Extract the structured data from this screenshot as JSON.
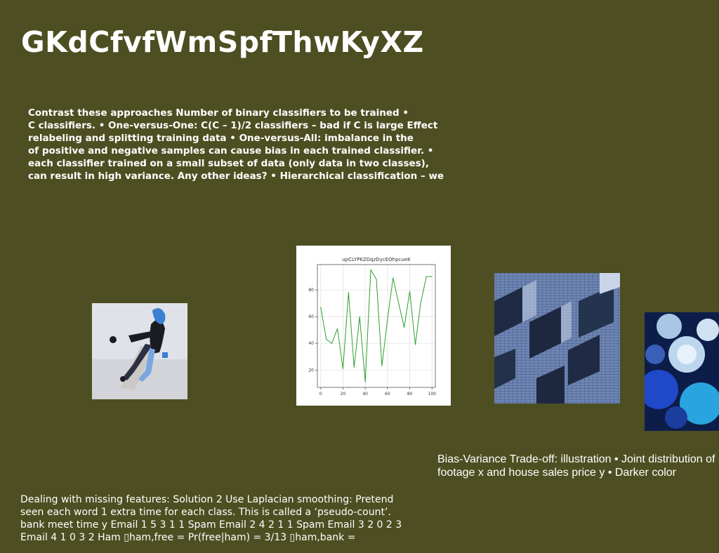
{
  "slide": {
    "title": "GKdCfvfWmSpfThwKyXZ",
    "paragraph": "Contrast these approaches Number of binary classifiers to be trained •\nC classifiers. • One-versus-One: C(C – 1)/2 classifiers – bad if C is large Effect\nrelabeling and splitting training data • One-versus-All: imbalance in the\nof positive and negative samples can cause bias in each trained classifier. •\neach classifier trained on a small subset of data (only data in two classes),\ncan result in high variance. Any other ideas? • Hierarchical classification – we",
    "caption": "Bias-Variance Trade-off: illustration • Joint distribution of\nfootage x and house sales price y • Darker color",
    "bottom_text": "Dealing with missing features: Solution 2 Use Laplacian smoothing: Pretend\nseen each word 1 extra time for each class. This is called a ‘pseudo-count’.\nbank meet time y Email 1 5 3 1 1 Spam Email 2 4 2 1 1 Spam Email 3 2 0 2 3\nEmail 4 1 0 3 2 Ham ▯ham,free = Pr(free|ham) = 3/13 ▯ham,bank ="
  },
  "images": {
    "skater": "person-skating-photo",
    "building": "building-facade-photo",
    "flowers": "blue-flowers-photo"
  },
  "chart_data": {
    "type": "line",
    "title": "upCLYPKZDqzDycEOhpcueK",
    "x": [
      0,
      5,
      10,
      15,
      20,
      25,
      30,
      35,
      40,
      45,
      50,
      55,
      60,
      65,
      70,
      75,
      80,
      85,
      90,
      95,
      100
    ],
    "series": [
      {
        "values": [
          67,
          43,
          40,
          51,
          21,
          78,
          22,
          60,
          11,
          95,
          88,
          23,
          58,
          89,
          70,
          52,
          79,
          39,
          71,
          90,
          90
        ]
      }
    ],
    "x_ticks": [
      0,
      20,
      40,
      60,
      80,
      100
    ],
    "y_ticks": [
      20,
      40,
      60,
      80
    ],
    "xlim": [
      -3,
      103
    ],
    "ylim": [
      7,
      99
    ],
    "grid": true,
    "line_color": "#2ca02c"
  }
}
